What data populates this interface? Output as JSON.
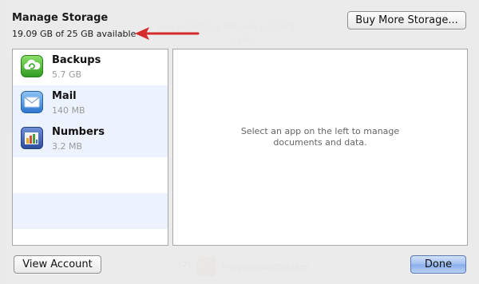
{
  "background": {
    "line1": "nek beállítja a fiókokat a Címtár",
    "line2": "okhoz.",
    "row_check": "✓",
    "row_label": "Fényképadatfolyam"
  },
  "dialog": {
    "title": "Manage Storage",
    "available": "19.09 GB of 25 GB available",
    "buy_more_label": "Buy More Storage...",
    "view_account_label": "View Account",
    "done_label": "Done",
    "placeholder": "Select an app on the left to manage\ndocuments and data.",
    "apps": [
      {
        "name": "Backups",
        "size": "5.7 GB",
        "icon": "backups-icon"
      },
      {
        "name": "Mail",
        "size": "140 MB",
        "icon": "mail-icon"
      },
      {
        "name": "Numbers",
        "size": "3.2 MB",
        "icon": "numbers-icon"
      }
    ]
  },
  "colors": {
    "arrow": "#d42b2b",
    "list_stripe": "#edf3fe",
    "done_button": "#88adea"
  }
}
